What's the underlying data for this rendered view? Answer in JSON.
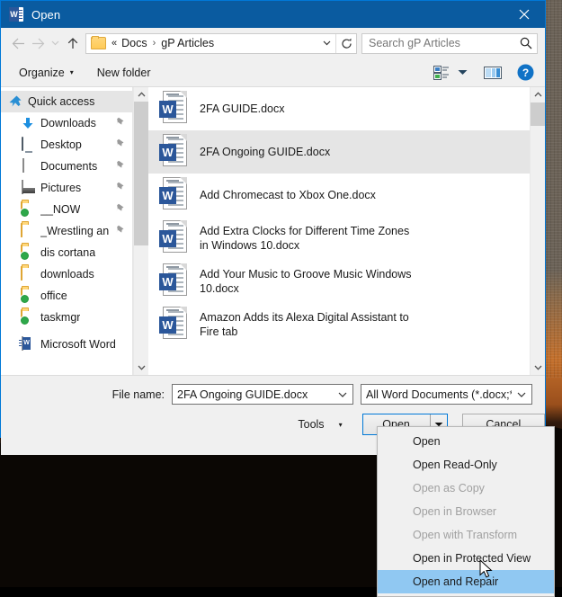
{
  "window": {
    "title": "Open",
    "app_icon": "word-icon",
    "close_label": "✕",
    "titlebar_color": "#0a5ba0"
  },
  "nav": {
    "back_icon": "back-arrow-icon",
    "forward_icon": "forward-arrow-icon",
    "recent_icon": "chevron-down-icon",
    "up_icon": "up-arrow-icon",
    "breadcrumb": {
      "folder_icon": "folder-icon",
      "overflow": "«",
      "items": [
        "Docs",
        "gP Articles"
      ],
      "separator": "›"
    },
    "address_dropdown_icon": "chevron-down-icon",
    "refresh_icon": "refresh-icon",
    "search": {
      "placeholder": "Search gP Articles",
      "value": "",
      "icon": "search-icon"
    }
  },
  "commandbar": {
    "organize_label": "Organize",
    "organize_caret": "▾",
    "new_folder_label": "New folder",
    "view_icon": "view-list-icon",
    "view_caret": "▾",
    "preview_icon": "preview-pane-icon",
    "help_icon": "help-icon",
    "help_glyph": "?"
  },
  "sidebar": {
    "items": [
      {
        "label": "Quick access",
        "icon": "pin-star-icon",
        "selected": true,
        "root": true,
        "pinned": false
      },
      {
        "label": "Downloads",
        "icon": "downloads-icon",
        "selected": false,
        "root": false,
        "pinned": true
      },
      {
        "label": "Desktop",
        "icon": "desktop-icon",
        "selected": false,
        "root": false,
        "pinned": true
      },
      {
        "label": "Documents",
        "icon": "documents-icon",
        "selected": false,
        "root": false,
        "pinned": true
      },
      {
        "label": "Pictures",
        "icon": "pictures-icon",
        "selected": false,
        "root": false,
        "pinned": true
      },
      {
        "label": "__NOW",
        "icon": "folder-sync-icon",
        "selected": false,
        "root": false,
        "pinned": true
      },
      {
        "label": "_Wrestling an",
        "icon": "folder-icon",
        "selected": false,
        "root": false,
        "pinned": true
      },
      {
        "label": "dis cortana",
        "icon": "folder-sync-icon",
        "selected": false,
        "root": false,
        "pinned": false
      },
      {
        "label": "downloads",
        "icon": "folder-icon",
        "selected": false,
        "root": false,
        "pinned": false
      },
      {
        "label": "office",
        "icon": "folder-sync-icon",
        "selected": false,
        "root": false,
        "pinned": false
      },
      {
        "label": "taskmgr",
        "icon": "folder-sync-icon",
        "selected": false,
        "root": false,
        "pinned": false
      },
      {
        "label": "Microsoft Word",
        "icon": "word-small-icon",
        "selected": false,
        "root": true,
        "pinned": false
      }
    ],
    "pin_glyph": "⚑",
    "scroll_up_icon": "scroll-up-icon",
    "scroll_down_icon": "scroll-down-icon"
  },
  "filelist": {
    "files": [
      {
        "name": "2FA GUIDE.docx",
        "icon": "word-document-icon",
        "selected": false
      },
      {
        "name": "2FA Ongoing GUIDE.docx",
        "icon": "word-document-icon",
        "selected": true
      },
      {
        "name": "Add Chromecast to Xbox One.docx",
        "icon": "word-document-icon",
        "selected": false
      },
      {
        "name": "Add Extra Clocks for Different Time Zones in Windows 10.docx",
        "icon": "word-document-icon",
        "selected": false
      },
      {
        "name": "Add Your Music to Groove Music Windows 10.docx",
        "icon": "word-document-icon",
        "selected": false
      },
      {
        "name": "Amazon Adds its Alexa Digital Assistant to Fire tab",
        "icon": "word-document-icon",
        "selected": false
      }
    ],
    "scroll_up_icon": "scroll-up-icon",
    "scroll_down_icon": "scroll-down-icon"
  },
  "footer": {
    "filename_label": "File name:",
    "filename_value": "2FA Ongoing GUIDE.docx",
    "filename_caret": "⌄",
    "filetype_value": "All Word Documents (*.docx;*.d",
    "filetype_caret": "⌄",
    "tools_label": "Tools",
    "tools_caret": "▾",
    "open_label": "Open",
    "open_split_caret": "▾",
    "cancel_label": "Cancel",
    "accent_color": "#0078d7"
  },
  "open_menu": {
    "items": [
      {
        "label": "Open",
        "disabled": false,
        "highlighted": false
      },
      {
        "label": "Open Read-Only",
        "disabled": false,
        "highlighted": false
      },
      {
        "label": "Open as Copy",
        "disabled": true,
        "highlighted": false
      },
      {
        "label": "Open in Browser",
        "disabled": true,
        "highlighted": false
      },
      {
        "label": "Open with Transform",
        "disabled": true,
        "highlighted": false
      },
      {
        "label": "Open in Protected View",
        "disabled": false,
        "highlighted": false
      },
      {
        "label": "Open and Repair",
        "disabled": false,
        "highlighted": true
      }
    ],
    "highlight_color": "#90c8f2"
  },
  "cursor": {
    "icon": "mouse-pointer-icon"
  }
}
